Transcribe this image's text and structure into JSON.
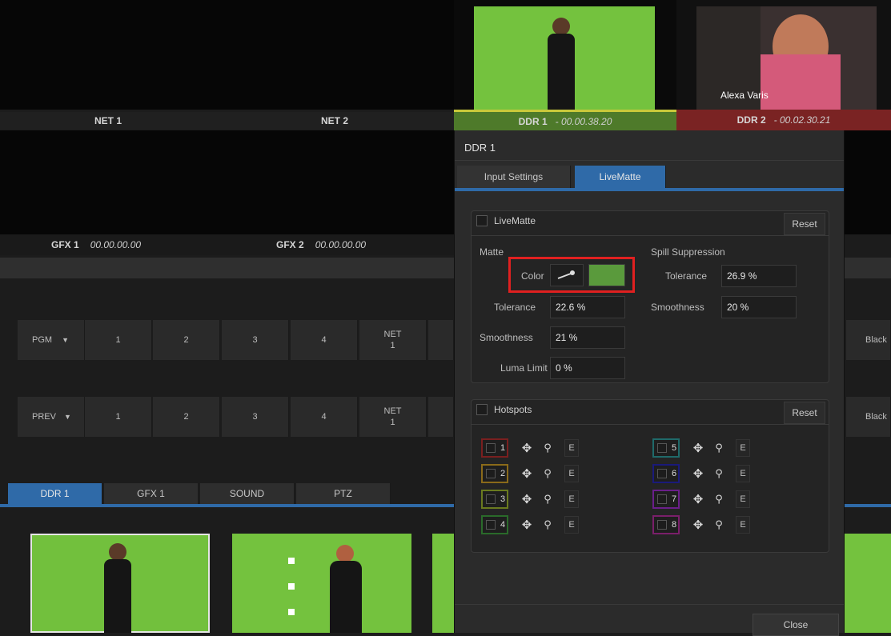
{
  "monitors": {
    "net1_label": "NET 1",
    "net2_label": "NET 2",
    "ddr1_label": "DDR 1",
    "ddr1_time": "- 00.00.38.20",
    "ddr2_label": "DDR 2",
    "ddr2_time": "- 00.02.30.21",
    "ddr2_caption": "Alexa Varis",
    "gfx1_label": "GFX 1",
    "gfx1_time": "00.00.00.00",
    "gfx2_label": "GFX 2",
    "gfx2_time": "00.00.00.00"
  },
  "switcher": {
    "pgm_label": "PGM",
    "prev_label": "PREV",
    "buttons": [
      "1",
      "2",
      "3",
      "4"
    ],
    "net_label": "NET",
    "net_num": "1",
    "black_label": "Black"
  },
  "bottom_tabs": [
    "DDR 1",
    "GFX 1",
    "SOUND",
    "PTZ"
  ],
  "panel": {
    "title": "DDR 1",
    "tabs": [
      "Input Settings",
      "LiveMatte"
    ],
    "livematte": {
      "section_label": "LiveMatte",
      "reset_label": "Reset",
      "matte_label": "Matte",
      "color_label": "Color",
      "matte_color": "#5a9a3c",
      "tolerance_label": "Tolerance",
      "tolerance_value": "22.6 %",
      "smoothness_label": "Smoothness",
      "smoothness_value": "21 %",
      "luma_label": "Luma Limit",
      "luma_value": "0 %",
      "spill_label": "Spill Suppression",
      "spill_tolerance_label": "Tolerance",
      "spill_tolerance_value": "26.9 %",
      "spill_smoothness_label": "Smoothness",
      "spill_smoothness_value": "20 %"
    },
    "hotspots": {
      "section_label": "Hotspots",
      "reset_label": "Reset",
      "e_label": "E",
      "items": [
        {
          "num": "1",
          "color": "#7a1f1f"
        },
        {
          "num": "2",
          "color": "#8a6a1a"
        },
        {
          "num": "3",
          "color": "#6a7a1f"
        },
        {
          "num": "4",
          "color": "#2a6a2a"
        },
        {
          "num": "5",
          "color": "#1f6a6a"
        },
        {
          "num": "6",
          "color": "#1a1a7a"
        },
        {
          "num": "7",
          "color": "#6a1f8a"
        },
        {
          "num": "8",
          "color": "#7a1f6a"
        }
      ]
    },
    "close_label": "Close"
  }
}
